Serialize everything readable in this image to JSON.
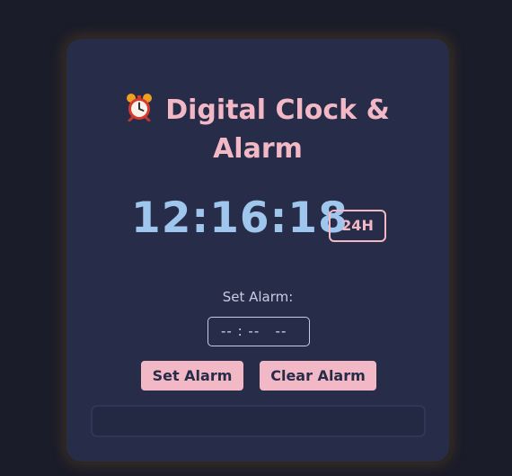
{
  "app": {
    "title_line1": "Digital Clock &",
    "title_line2": "Alarm",
    "title_icon": "alarm-clock-icon"
  },
  "clock": {
    "time": "12:16:18",
    "format_label": "24H"
  },
  "alarm": {
    "label": "Set Alarm:",
    "input_value": "-- : --   --",
    "set_button_label": "Set Alarm",
    "clear_button_label": "Clear Alarm",
    "status": ""
  },
  "colors": {
    "page_background": "#1b1c29",
    "card_background": "#272c48",
    "accent_pink": "#f2b8c6",
    "clock_blue": "#9fc7ee",
    "label_text": "#c9cbe2"
  }
}
